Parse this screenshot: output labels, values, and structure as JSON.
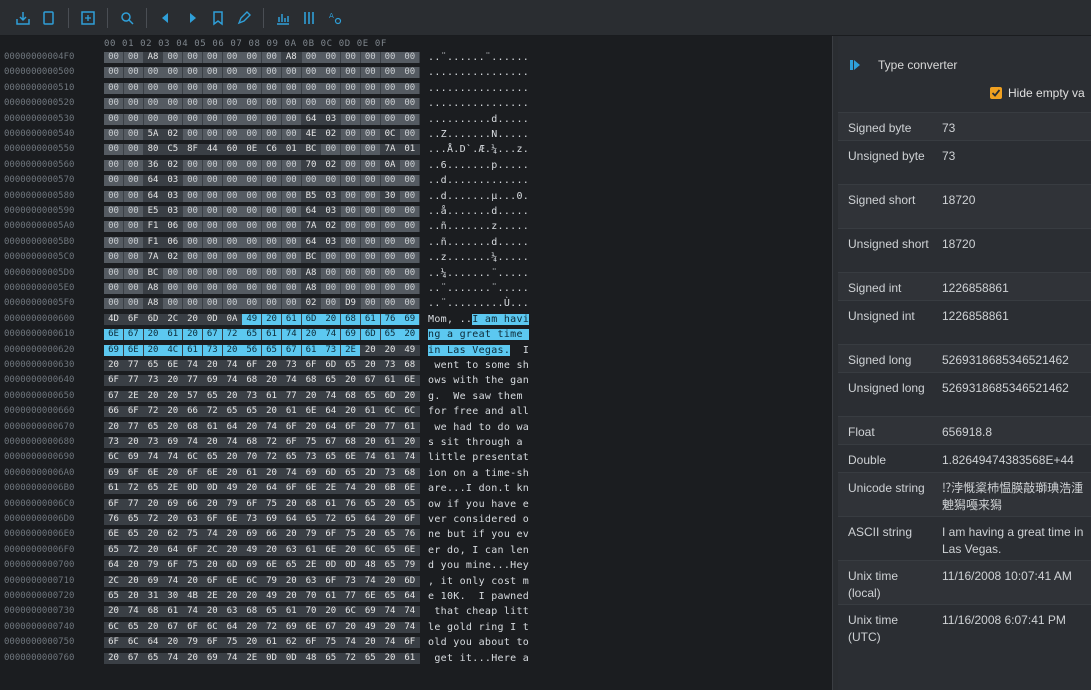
{
  "toolbar": {
    "buttons": [
      "save-icon",
      "copy-icon",
      "save-as-icon",
      "search-icon",
      "back-icon",
      "forward-icon",
      "bookmark-icon",
      "edit-icon",
      "chart-icon",
      "columns-icon",
      "encoding-icon"
    ]
  },
  "hex": {
    "header": "00 01 02 03 04 05 06 07 08 09 0A 0B 0C 0D 0E 0F",
    "rows": [
      {
        "addr": "00000000004F0",
        "bytes": "00 00 A8 00 00 00 00 00 00 A8 00 00 00 00 00 00",
        "ascii": "..¨......¨......"
      },
      {
        "addr": "0000000000500",
        "bytes": "00 00 00 00 00 00 00 00 00 00 00 00 00 00 00 00",
        "ascii": "................"
      },
      {
        "addr": "0000000000510",
        "bytes": "00 00 00 00 00 00 00 00 00 00 00 00 00 00 00 00",
        "ascii": "................"
      },
      {
        "addr": "0000000000520",
        "bytes": "00 00 00 00 00 00 00 00 00 00 00 00 00 00 00 00",
        "ascii": "................"
      },
      {
        "addr": "0000000000530",
        "bytes": "00 00 00 00 00 00 00 00 00 00 64 03 00 00 00 00",
        "ascii": "..........d....."
      },
      {
        "addr": "0000000000540",
        "bytes": "00 00 5A 02 00 00 00 00 00 00 4E 02 00 00 0C 00",
        "ascii": "..Z.......N....."
      },
      {
        "addr": "0000000000550",
        "bytes": "00 00 80 C5 8F 44 60 0E C6 01 BC 00 00 00 7A 01",
        "ascii": "...Å.D`.Æ.¼...z."
      },
      {
        "addr": "0000000000560",
        "bytes": "00 00 36 02 00 00 00 00 00 00 70 02 00 00 0A 00",
        "ascii": "..6.......p....."
      },
      {
        "addr": "0000000000570",
        "bytes": "00 00 64 03 00 00 00 00 00 00 00 00 00 00 00 00",
        "ascii": "..d............."
      },
      {
        "addr": "0000000000580",
        "bytes": "00 00 64 03 00 00 00 00 00 00 B5 03 00 00 30 00",
        "ascii": "..d.......µ...0."
      },
      {
        "addr": "0000000000590",
        "bytes": "00 00 E5 03 00 00 00 00 00 00 64 03 00 00 00 00",
        "ascii": "..å.......d....."
      },
      {
        "addr": "00000000005A0",
        "bytes": "00 00 F1 06 00 00 00 00 00 00 7A 02 00 00 00 00",
        "ascii": "..ñ.......z....."
      },
      {
        "addr": "00000000005B0",
        "bytes": "00 00 F1 06 00 00 00 00 00 00 64 03 00 00 00 00",
        "ascii": "..ñ.......d....."
      },
      {
        "addr": "00000000005C0",
        "bytes": "00 00 7A 02 00 00 00 00 00 00 BC 00 00 00 00 00",
        "ascii": "..z.......¼....."
      },
      {
        "addr": "00000000005D0",
        "bytes": "00 00 BC 00 00 00 00 00 00 00 A8 00 00 00 00 00",
        "ascii": "..¼.......¨....."
      },
      {
        "addr": "00000000005E0",
        "bytes": "00 00 A8 00 00 00 00 00 00 00 A8 00 00 00 00 00",
        "ascii": "..¨.......¨....."
      },
      {
        "addr": "00000000005F0",
        "bytes": "00 00 A8 00 00 00 00 00 00 00 02 00 D9 00 00 00",
        "ascii": "..¨.........Ù..."
      },
      {
        "addr": "0000000000600",
        "bytes": "4D 6F 6D 2C 20 0D 0A 49 20 61 6D 20 68 61 76 69",
        "ascii": "Mom, ..I am havi",
        "sel_from": 7
      },
      {
        "addr": "0000000000610",
        "bytes": "6E 67 20 61 20 67 72 65 61 74 20 74 69 6D 65 20",
        "ascii": "ng a great time ",
        "sel_from": 0
      },
      {
        "addr": "0000000000620",
        "bytes": "69 6E 20 4C 61 73 20 56 65 67 61 73 2E 20 20 49",
        "ascii": "in Las Vegas.  I",
        "sel_from": 0,
        "sel_to": 12
      },
      {
        "addr": "0000000000630",
        "bytes": "20 77 65 6E 74 20 74 6F 20 73 6F 6D 65 20 73 68",
        "ascii": " went to some sh"
      },
      {
        "addr": "0000000000640",
        "bytes": "6F 77 73 20 77 69 74 68 20 74 68 65 20 67 61 6E",
        "ascii": "ows with the gan"
      },
      {
        "addr": "0000000000650",
        "bytes": "67 2E 20 20 57 65 20 73 61 77 20 74 68 65 6D 20",
        "ascii": "g.  We saw them "
      },
      {
        "addr": "0000000000660",
        "bytes": "66 6F 72 20 66 72 65 65 20 61 6E 64 20 61 6C 6C",
        "ascii": "for free and all"
      },
      {
        "addr": "0000000000670",
        "bytes": "20 77 65 20 68 61 64 20 74 6F 20 64 6F 20 77 61",
        "ascii": " we had to do wa"
      },
      {
        "addr": "0000000000680",
        "bytes": "73 20 73 69 74 20 74 68 72 6F 75 67 68 20 61 20",
        "ascii": "s sit through a "
      },
      {
        "addr": "0000000000690",
        "bytes": "6C 69 74 74 6C 65 20 70 72 65 73 65 6E 74 61 74",
        "ascii": "little presentat"
      },
      {
        "addr": "00000000006A0",
        "bytes": "69 6F 6E 20 6F 6E 20 61 20 74 69 6D 65 2D 73 68",
        "ascii": "ion on a time-sh"
      },
      {
        "addr": "00000000006B0",
        "bytes": "61 72 65 2E 0D 0D 49 20 64 6F 6E 2E 74 20 6B 6E",
        "ascii": "are...I don.t kn"
      },
      {
        "addr": "00000000006C0",
        "bytes": "6F 77 20 69 66 20 79 6F 75 20 68 61 76 65 20 65",
        "ascii": "ow if you have e"
      },
      {
        "addr": "00000000006D0",
        "bytes": "76 65 72 20 63 6F 6E 73 69 64 65 72 65 64 20 6F",
        "ascii": "ver considered o"
      },
      {
        "addr": "00000000006E0",
        "bytes": "6E 65 20 62 75 74 20 69 66 20 79 6F 75 20 65 76",
        "ascii": "ne but if you ev"
      },
      {
        "addr": "00000000006F0",
        "bytes": "65 72 20 64 6F 2C 20 49 20 63 61 6E 20 6C 65 6E",
        "ascii": "er do, I can len"
      },
      {
        "addr": "0000000000700",
        "bytes": "64 20 79 6F 75 20 6D 69 6E 65 2E 0D 0D 48 65 79",
        "ascii": "d you mine...Hey"
      },
      {
        "addr": "0000000000710",
        "bytes": "2C 20 69 74 20 6F 6E 6C 79 20 63 6F 73 74 20 6D",
        "ascii": ", it only cost m"
      },
      {
        "addr": "0000000000720",
        "bytes": "65 20 31 30 4B 2E 20 20 49 20 70 61 77 6E 65 64",
        "ascii": "e 10K.  I pawned"
      },
      {
        "addr": "0000000000730",
        "bytes": "20 74 68 61 74 20 63 68 65 61 70 20 6C 69 74 74",
        "ascii": " that cheap litt"
      },
      {
        "addr": "0000000000740",
        "bytes": "6C 65 20 67 6F 6C 64 20 72 69 6E 67 20 49 20 74",
        "ascii": "le gold ring I t"
      },
      {
        "addr": "0000000000750",
        "bytes": "6F 6C 64 20 79 6F 75 20 61 62 6F 75 74 20 74 6F",
        "ascii": "old you about to"
      },
      {
        "addr": "0000000000760",
        "bytes": "20 67 65 74 20 69 74 2E 0D 0D 48 65 72 65 20 61",
        "ascii": " get it...Here a"
      }
    ]
  },
  "panel": {
    "title": "Type converter",
    "hide_empty_label": "Hide empty va",
    "rows": [
      {
        "name": "Signed byte",
        "value": "73"
      },
      {
        "name": "Unsigned byte",
        "value": "73"
      },
      {
        "name": "Signed short",
        "value": "18720"
      },
      {
        "name": "Unsigned short",
        "value": "18720"
      },
      {
        "name": "Signed int",
        "value": "1226858861"
      },
      {
        "name": "Unsigned int",
        "value": "1226858861"
      },
      {
        "name": "Signed long",
        "value": "5269318685346521462"
      },
      {
        "name": "Unsigned long",
        "value": "5269318685346521462"
      },
      {
        "name": "Float",
        "value": "656918.8"
      },
      {
        "name": "Double",
        "value": "1.82649474383568E+44"
      },
      {
        "name": "Unicode string",
        "value": "⁉浡慨楶杮愠朠敲瑡琠浩⁥湩䰠獡嘠来獡"
      },
      {
        "name": "ASCII string",
        "value": "I am having a great time in Las Vegas."
      },
      {
        "name": "Unix time (local)",
        "value": "11/16/2008 10:07:41 AM"
      },
      {
        "name": "Unix time (UTC)",
        "value": "11/16/2008 6:07:41 PM"
      }
    ]
  },
  "colors": {
    "accent": "#2f9fd8",
    "selection": "#5cc8f0",
    "checkbox": "#f0a020"
  }
}
